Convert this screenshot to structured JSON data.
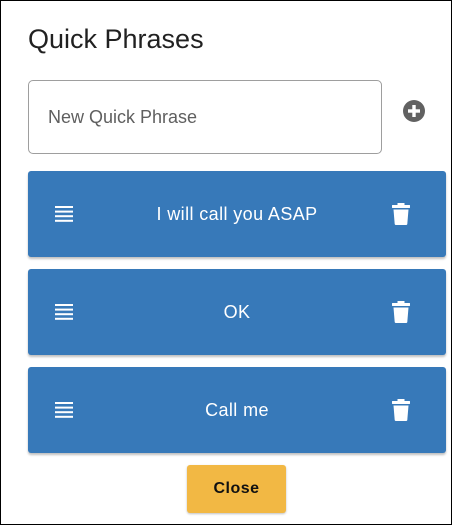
{
  "dialog": {
    "title": "Quick Phrases",
    "new_phrase_placeholder": "New Quick Phrase",
    "new_phrase_value": "",
    "add_icon": "plus-circle-icon",
    "drag_icon": "drag-handle-icon",
    "delete_icon": "trash-icon",
    "phrases": [
      {
        "label": "I will call you ASAP"
      },
      {
        "label": "OK"
      },
      {
        "label": "Call me"
      }
    ],
    "close_label": "Close"
  },
  "colors": {
    "phrase_bg": "#3779b9",
    "close_bg": "#f2b844",
    "add_icon": "#616161"
  }
}
